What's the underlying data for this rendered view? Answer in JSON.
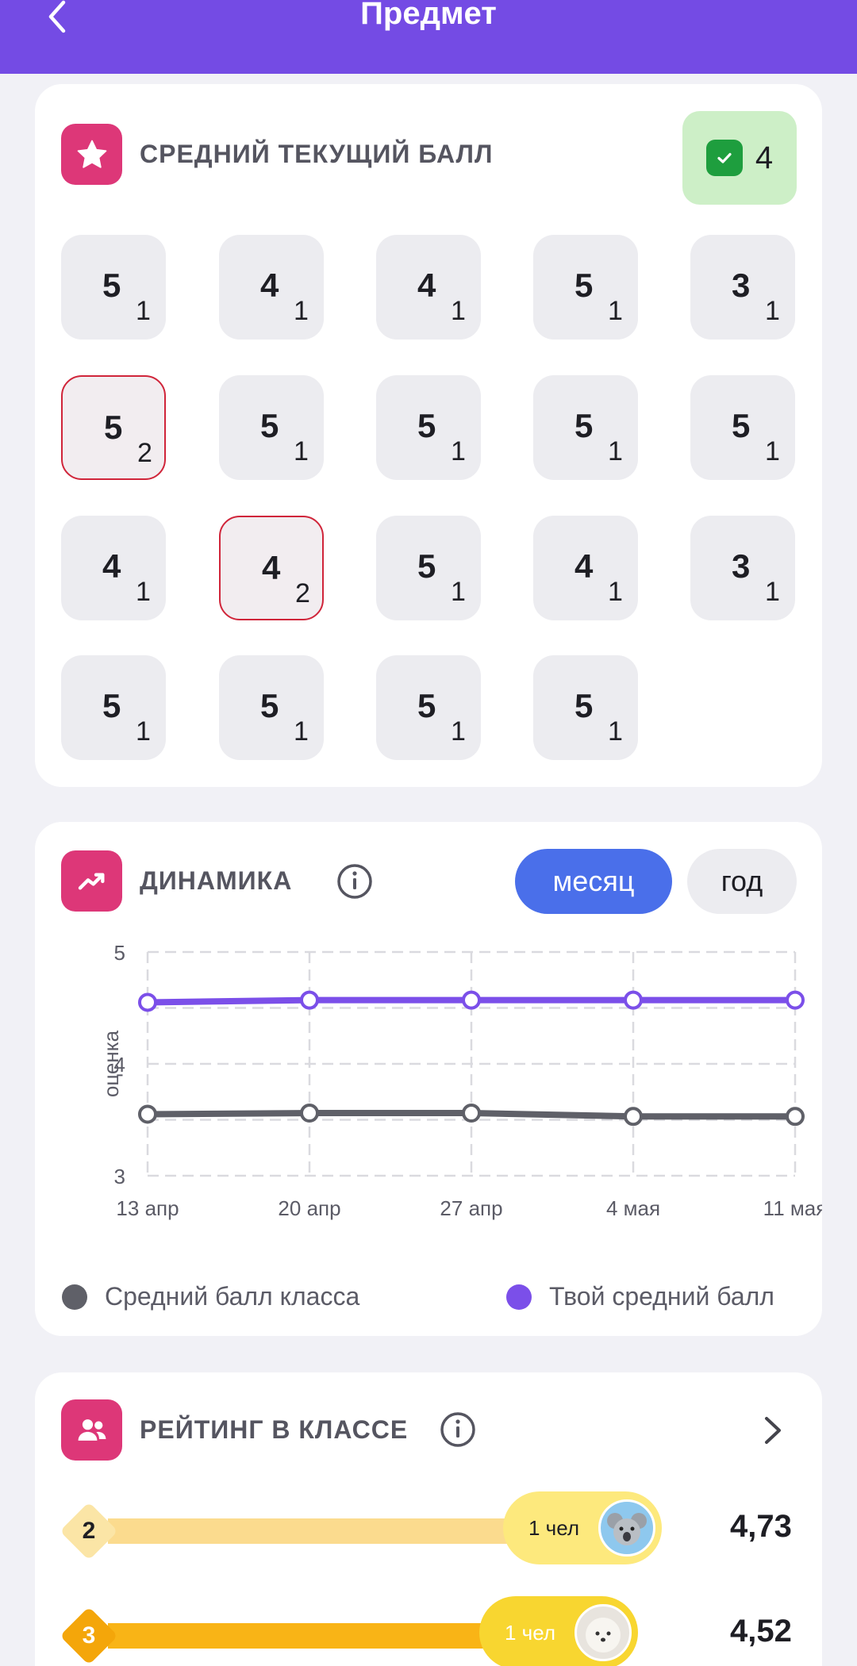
{
  "header": {
    "title": "Предмет",
    "back_icon": "chevron-left-icon"
  },
  "colors": {
    "header_bg": "#744BE4",
    "icon_pink": "#DD3778",
    "accent_blue": "#4A6FEA",
    "your_avg": "#7B4FE9",
    "class_avg": "#5F6068",
    "good_green": "#1E9E3E",
    "weighted_border": "#D0253A"
  },
  "grades_card": {
    "title": "СРЕДНИЙ ТЕКУЩИЙ БАЛЛ",
    "icon": "star-icon",
    "average": "4",
    "grades": [
      {
        "value": "5",
        "weight": "1"
      },
      {
        "value": "4",
        "weight": "1"
      },
      {
        "value": "4",
        "weight": "1"
      },
      {
        "value": "5",
        "weight": "1"
      },
      {
        "value": "3",
        "weight": "1"
      },
      {
        "value": "5",
        "weight": "2"
      },
      {
        "value": "5",
        "weight": "1"
      },
      {
        "value": "5",
        "weight": "1"
      },
      {
        "value": "5",
        "weight": "1"
      },
      {
        "value": "5",
        "weight": "1"
      },
      {
        "value": "4",
        "weight": "1"
      },
      {
        "value": "4",
        "weight": "2"
      },
      {
        "value": "5",
        "weight": "1"
      },
      {
        "value": "4",
        "weight": "1"
      },
      {
        "value": "3",
        "weight": "1"
      },
      {
        "value": "5",
        "weight": "1"
      },
      {
        "value": "5",
        "weight": "1"
      },
      {
        "value": "5",
        "weight": "1"
      },
      {
        "value": "5",
        "weight": "1"
      }
    ]
  },
  "dynamics_card": {
    "title": "ДИНАМИКА",
    "icon": "trending-up-icon",
    "period_month": "месяц",
    "period_year": "год",
    "legend_class": "Средний балл класса",
    "legend_you": "Твой средний балл"
  },
  "chart_data": {
    "type": "line",
    "ylabel": "оценка",
    "xlabel": "",
    "ylim": [
      3,
      5
    ],
    "yticks": [
      "5",
      "4",
      "3"
    ],
    "categories": [
      "13 апр",
      "20 апр",
      "27 апр",
      "4 мая",
      "11 мая"
    ],
    "series": [
      {
        "name": "Твой средний балл",
        "color": "#7B4FE9",
        "values": [
          4.55,
          4.57,
          4.57,
          4.57,
          4.57
        ]
      },
      {
        "name": "Средний балл класса",
        "color": "#5F6068",
        "values": [
          3.55,
          3.56,
          3.56,
          3.53,
          3.53
        ]
      }
    ],
    "grid": true,
    "legend_position": "bottom"
  },
  "rating_card": {
    "title": "РЕЙТИНГ В КЛАССЕ",
    "icon": "users-icon",
    "rows": [
      {
        "rank": "2",
        "people": "1 чел",
        "score": "4,73",
        "color": "#FBDB8E",
        "pill": "#FDE97D",
        "diamond": "#FBE5A6",
        "text": "#1E1E24"
      },
      {
        "rank": "3",
        "people": "1 чел",
        "score": "4,52",
        "color": "#F9B416",
        "pill": "#F8D630",
        "diamond": "#F4A60A",
        "text": "#fff"
      }
    ]
  }
}
